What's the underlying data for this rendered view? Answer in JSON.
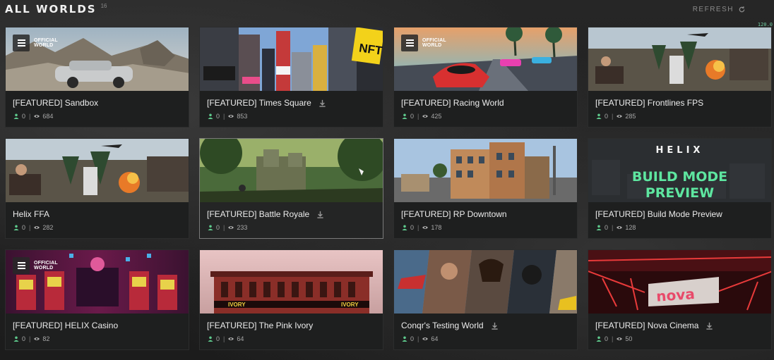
{
  "header": {
    "title": "ALL WORLDS",
    "count": "16",
    "refresh_label": "REFRESH",
    "fps": "120.0"
  },
  "badge": {
    "line1": "OFFICIAL",
    "line2": "WORLD"
  },
  "cards": [
    {
      "title": "[FEATURED] Sandbox",
      "players": "0",
      "views": "684"
    },
    {
      "title": "[FEATURED] Times Square",
      "players": "0",
      "views": "853",
      "download": true
    },
    {
      "title": "[FEATURED] Racing World",
      "players": "0",
      "views": "425"
    },
    {
      "title": "[FEATURED] Frontlines FPS",
      "players": "0",
      "views": "285"
    },
    {
      "title": "Helix FFA",
      "players": "0",
      "views": "282"
    },
    {
      "title": "[FEATURED] Battle Royale",
      "players": "0",
      "views": "233",
      "download": true
    },
    {
      "title": "[FEATURED] RP Downtown",
      "players": "0",
      "views": "178"
    },
    {
      "title": "[FEATURED] Build Mode Preview",
      "players": "0",
      "views": "128"
    },
    {
      "title": "[FEATURED] HELIX Casino",
      "players": "0",
      "views": "82"
    },
    {
      "title": "[FEATURED] The Pink Ivory",
      "players": "0",
      "views": "64"
    },
    {
      "title": "Conqr's Testing World",
      "players": "0",
      "views": "64",
      "download": true
    },
    {
      "title": "[FEATURED] Nova Cinema",
      "players": "0",
      "views": "50",
      "download": true
    }
  ],
  "thumb_text": {
    "nft": "NFT",
    "helix": "HELIX",
    "build1": "BUILD MODE",
    "build2": "PREVIEW",
    "nova": "nova",
    "ivory": "IVORY"
  },
  "colors": {
    "card_bg": "#1e1f1f",
    "accent_green": "#5ee6a0",
    "text": "#ececec",
    "muted": "#a8a8a8"
  }
}
